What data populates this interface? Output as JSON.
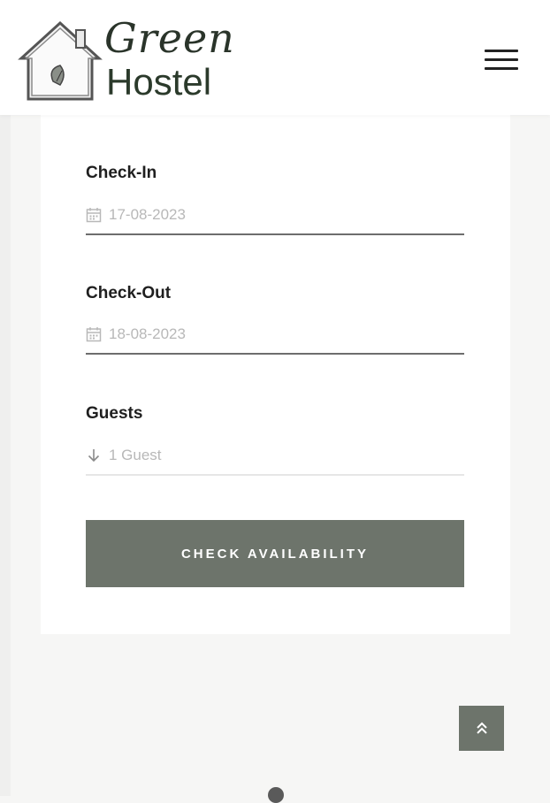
{
  "header": {
    "logo_script": "Green",
    "logo_hostel": "Hostel",
    "menu_icon": "hamburger-menu-icon"
  },
  "booking": {
    "checkin": {
      "label": "Check-In",
      "value": "17-08-2023",
      "icon": "calendar-icon"
    },
    "checkout": {
      "label": "Check-Out",
      "value": "18-08-2023",
      "icon": "calendar-icon"
    },
    "guests": {
      "label": "Guests",
      "value": "1 Guest",
      "icon": "arrow-down-icon"
    },
    "submit_label": "CHECK AVAILABILITY"
  },
  "back_to_top_icon": "double-chevron-up-icon",
  "colors": {
    "accent": "#6d746b",
    "page_bg": "#f6f6f5",
    "card_bg": "#ffffff",
    "placeholder": "#b8b8b8"
  }
}
